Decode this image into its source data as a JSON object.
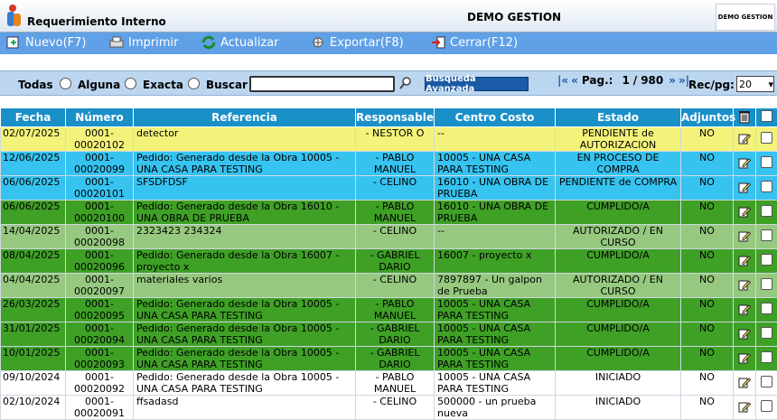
{
  "app": {
    "title": "Requerimiento Interno",
    "company": "DEMO GESTION",
    "brand": "DEMO GESTION"
  },
  "toolbar": {
    "nuevo": "Nuevo(F7)",
    "imprimir": "Imprimir",
    "actualizar": "Actualizar",
    "exportar": "Exportar(F8)",
    "cerrar": "Cerrar(F12)"
  },
  "search": {
    "todas": "Todas",
    "alguna": "Alguna",
    "exacta": "Exacta",
    "buscar": "Buscar",
    "value": "",
    "advanced": "Busqueda Avanzada"
  },
  "pager": {
    "prefix": "Pag.:",
    "current": "1",
    "total": "980",
    "recpg_label": "Rec/pg:",
    "recpg_value": "20"
  },
  "table": {
    "headers": [
      "Fecha",
      "Número",
      "Referencia",
      "Responsable",
      "Centro Costo",
      "Estado",
      "Adjuntos"
    ],
    "rows": [
      {
        "fecha": "02/07/2025",
        "numero": "0001-00020102",
        "referencia": "detector",
        "responsable": "- NESTOR O",
        "centro": "--",
        "estado": "PENDIENTE de AUTORIZACION",
        "adjuntos": "NO",
        "color": "yellow"
      },
      {
        "fecha": "12/06/2025",
        "numero": "0001-00020099",
        "referencia": "Pedido: Generado desde la Obra 10005 - UNA CASA PARA TESTING",
        "responsable": "- PABLO MANUEL",
        "centro": "10005 - UNA CASA PARA TESTING",
        "estado": "EN PROCESO DE COMPRA",
        "adjuntos": "NO",
        "color": "blue"
      },
      {
        "fecha": "06/06/2025",
        "numero": "0001-00020101",
        "referencia": "SFSDFDSF",
        "responsable": "- CELINO",
        "centro": "16010 - UNA OBRA DE PRUEBA",
        "estado": "PENDIENTE de COMPRA",
        "adjuntos": "NO",
        "color": "blue"
      },
      {
        "fecha": "06/06/2025",
        "numero": "0001-00020100",
        "referencia": "Pedido: Generado desde la Obra 16010 - UNA OBRA DE PRUEBA",
        "responsable": "- PABLO MANUEL",
        "centro": "16010 - UNA OBRA DE PRUEBA",
        "estado": "CUMPLIDO/A",
        "adjuntos": "NO",
        "color": "green"
      },
      {
        "fecha": "14/04/2025",
        "numero": "0001-00020098",
        "referencia": "2323423 234324",
        "responsable": "- CELINO",
        "centro": "--",
        "estado": "AUTORIZADO / EN CURSO",
        "adjuntos": "NO",
        "color": "lgreen"
      },
      {
        "fecha": "08/04/2025",
        "numero": "0001-00020096",
        "referencia": "Pedido: Generado desde la Obra 16007 - proyecto x",
        "responsable": "- GABRIEL DARIO",
        "centro": "16007 - proyecto x",
        "estado": "CUMPLIDO/A",
        "adjuntos": "NO",
        "color": "green"
      },
      {
        "fecha": "04/04/2025",
        "numero": "0001-00020097",
        "referencia": "materiales varios",
        "responsable": "- CELINO",
        "centro": "7897897 - Un galpon de Prueba",
        "estado": "AUTORIZADO / EN CURSO",
        "adjuntos": "NO",
        "color": "lgreen"
      },
      {
        "fecha": "26/03/2025",
        "numero": "0001-00020095",
        "referencia": "Pedido: Generado desde la Obra 10005 - UNA CASA PARA TESTING",
        "responsable": "- PABLO MANUEL",
        "centro": "10005 - UNA CASA PARA TESTING",
        "estado": "CUMPLIDO/A",
        "adjuntos": "NO",
        "color": "green"
      },
      {
        "fecha": "31/01/2025",
        "numero": "0001-00020094",
        "referencia": "Pedido: Generado desde la Obra 10005 - UNA CASA PARA TESTING",
        "responsable": "- GABRIEL DARIO",
        "centro": "10005 - UNA CASA PARA TESTING",
        "estado": "CUMPLIDO/A",
        "adjuntos": "NO",
        "color": "green"
      },
      {
        "fecha": "10/01/2025",
        "numero": "0001-00020093",
        "referencia": "Pedido: Generado desde la Obra 10005 - UNA CASA PARA TESTING",
        "responsable": "- GABRIEL DARIO",
        "centro": "10005 - UNA CASA PARA TESTING",
        "estado": "CUMPLIDO/A",
        "adjuntos": "NO",
        "color": "green"
      },
      {
        "fecha": "09/10/2024",
        "numero": "0001-00020092",
        "referencia": "Pedido: Generado desde la Obra 10005 - UNA CASA PARA TESTING",
        "responsable": "- PABLO MANUEL",
        "centro": "10005 - UNA CASA PARA TESTING",
        "estado": "INICIADO",
        "adjuntos": "NO",
        "color": "white"
      },
      {
        "fecha": "02/10/2024",
        "numero": "0001-00020091",
        "referencia": "ffsadasd",
        "responsable": "- CELINO",
        "centro": "500000 - un prueba nueva",
        "estado": "INICIADO",
        "adjuntos": "NO",
        "color": "white"
      }
    ]
  }
}
